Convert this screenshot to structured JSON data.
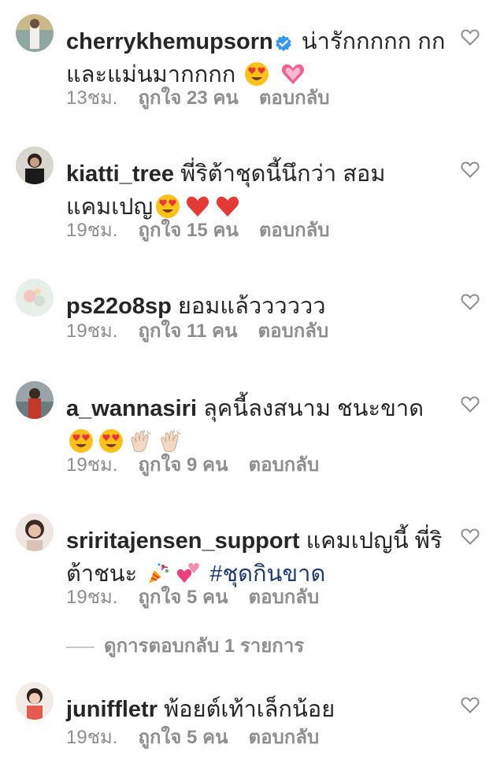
{
  "comments": [
    {
      "username": "cherrykhemupsorn",
      "verified": true,
      "text": "น่ารักกกกก กกและแม่นมากกกก",
      "emojis": [
        "heart-eyes-emoji",
        "pink-heart-emoji"
      ],
      "time": "13ชม.",
      "likes": "ถูกใจ 23 คน",
      "reply": "ตอบกลับ"
    },
    {
      "username": "kiatti_tree",
      "text": "พี่ริต้าชุดนี้นึกว่า สอม แคมเปญ",
      "emojis": [
        "heart-eyes-emoji",
        "red-heart-emoji",
        "red-heart-emoji"
      ],
      "time": "19ชม.",
      "likes": "ถูกใจ 15 คน",
      "reply": "ตอบกลับ"
    },
    {
      "username": "ps22o8sp",
      "text": "ยอมแล้วววววว",
      "time": "19ชม.",
      "likes": "ถูกใจ 11 คน",
      "reply": "ตอบกลับ"
    },
    {
      "username": "a_wannasiri",
      "text": "ลุคนี้ลงสนาม ชนะขาด",
      "emojis": [
        "heart-eyes-emoji",
        "heart-eyes-emoji",
        "clapping-hands-emoji",
        "clapping-hands-emoji"
      ],
      "time": "19ชม.",
      "likes": "ถูกใจ 9 คน",
      "reply": "ตอบกลับ"
    },
    {
      "username": "sriritajensen_support",
      "text": "แคมเปญนี้ พี่ริต้าชนะ",
      "emojis": [
        "party-popper-emoji",
        "two-hearts-emoji"
      ],
      "hashtag": "#ชุดกินขาด",
      "time": "19ชม.",
      "likes": "ถูกใจ 5 คน",
      "reply": "ตอบกลับ"
    },
    {
      "username": "juniffletr",
      "text": "พ้อยต์เท้าเล็กน้อย",
      "time": "19ชม.",
      "likes": "ถูกใจ 5 คน",
      "reply": "ตอบกลับ"
    }
  ],
  "view_replies": "ดูการตอบกลับ 1 รายการ",
  "colors": {
    "text": "#262626",
    "meta": "#8e8e8e",
    "hashtag": "#1e3a6e",
    "verified_badge": "#3897f0",
    "heart_outline": "#8e8e8e"
  }
}
